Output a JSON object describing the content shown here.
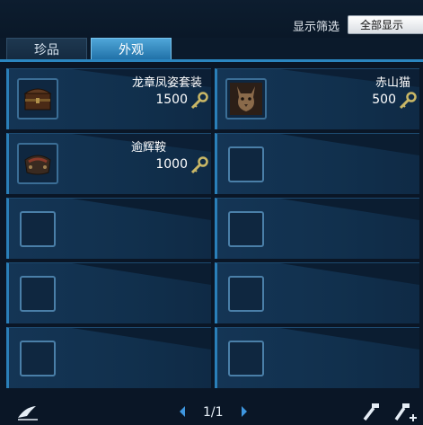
{
  "filter": {
    "label": "显示筛选",
    "selected": "全部显示"
  },
  "tabs": [
    {
      "label": "珍品",
      "active": false
    },
    {
      "label": "外观",
      "active": true
    }
  ],
  "items": [
    {
      "name": "龙章凤姿套装",
      "price": "1500",
      "icon": "chest-icon"
    },
    {
      "name": "赤山猫",
      "price": "500",
      "icon": "lynx-icon"
    },
    {
      "name": "逾辉鞍",
      "price": "1000",
      "icon": "saddle-icon"
    }
  ],
  "pager": {
    "text": "1/1"
  },
  "colors": {
    "accent": "#2b86c0",
    "tab_active": "#3f97cc",
    "card": "#143555",
    "key": "#c9b766"
  }
}
